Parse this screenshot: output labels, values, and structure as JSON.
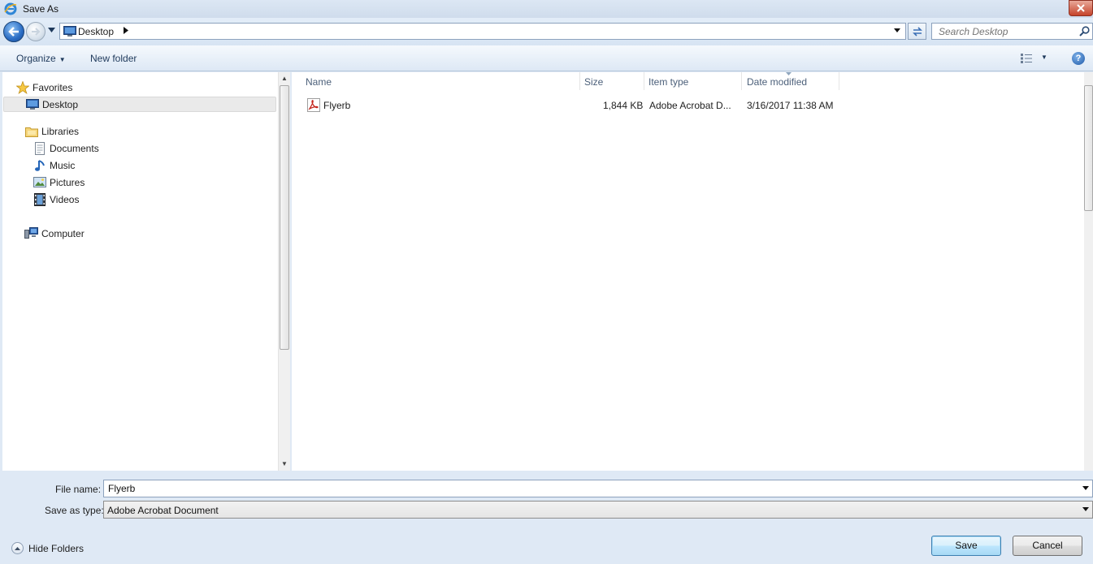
{
  "window": {
    "title": "Save As"
  },
  "navigation": {
    "address_crumb": "Desktop",
    "search_placeholder": "Search Desktop"
  },
  "toolbar": {
    "organize_label": "Organize",
    "new_folder_label": "New folder"
  },
  "sidebar": {
    "items": [
      {
        "label": "Favorites",
        "icon": "star-icon"
      },
      {
        "label": "Desktop",
        "icon": "desktop-icon",
        "selected": true
      },
      {
        "label": "Libraries",
        "icon": "libraries-icon"
      },
      {
        "label": "Documents",
        "icon": "documents-icon"
      },
      {
        "label": "Music",
        "icon": "music-icon"
      },
      {
        "label": "Pictures",
        "icon": "pictures-icon"
      },
      {
        "label": "Videos",
        "icon": "videos-icon"
      },
      {
        "label": "Computer",
        "icon": "computer-icon"
      }
    ]
  },
  "file_list": {
    "columns": [
      "Name",
      "Size",
      "Item type",
      "Date modified"
    ],
    "rows": [
      {
        "name": "Flyerb",
        "size": "1,844 KB",
        "type": "Adobe Acrobat D...",
        "date": "3/16/2017 11:38 AM",
        "icon": "pdf-icon"
      }
    ]
  },
  "form": {
    "file_name_label": "File name:",
    "file_name_value": "Flyerb",
    "save_type_label": "Save as type:",
    "save_type_value": "Adobe Acrobat Document"
  },
  "footer": {
    "hide_folders_label": "Hide Folders",
    "save_label": "Save",
    "cancel_label": "Cancel"
  },
  "colors": {
    "chrome_bg": "#dfe9f5",
    "close_button": "#c5432a",
    "accent_blue": "#1e395b"
  }
}
